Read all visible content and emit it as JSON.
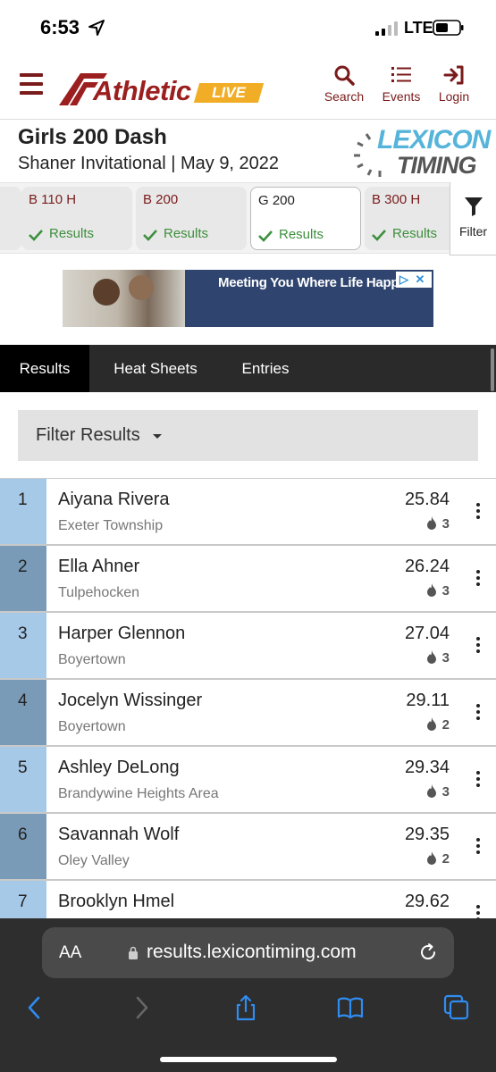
{
  "status_bar": {
    "time": "6:53",
    "network": "LTE"
  },
  "header": {
    "logo_text": "Athletic",
    "logo_badge": "LIVE",
    "nav": [
      {
        "label": "Search",
        "icon": "search-icon"
      },
      {
        "label": "Events",
        "icon": "list-icon"
      },
      {
        "label": "Login",
        "icon": "login-icon"
      }
    ]
  },
  "event": {
    "title": "Girls 200 Dash",
    "subtitle": "Shaner Invitational | May 9, 2022",
    "timer_logo_top": "LEXICON",
    "timer_logo_bottom": "TIMING"
  },
  "event_tabs": [
    {
      "name": "B 110 H",
      "status": "Results",
      "active": false
    },
    {
      "name": "B 200",
      "status": "Results",
      "active": false
    },
    {
      "name": "G 200",
      "status": "Results",
      "active": true
    },
    {
      "name": "B 300 H",
      "status": "Results",
      "active": false
    }
  ],
  "filter_label": "Filter",
  "ad": {
    "text": "Meeting You Where Life Happens"
  },
  "result_tabs": [
    {
      "label": "Results",
      "active": true
    },
    {
      "label": "Heat Sheets",
      "active": false
    },
    {
      "label": "Entries",
      "active": false
    }
  ],
  "filter_results_label": "Filter Results",
  "results": [
    {
      "place": "1",
      "name": "Aiyana Rivera",
      "team": "Exeter Township",
      "mark": "25.84",
      "heat": "3"
    },
    {
      "place": "2",
      "name": "Ella Ahner",
      "team": "Tulpehocken",
      "mark": "26.24",
      "heat": "3"
    },
    {
      "place": "3",
      "name": "Harper Glennon",
      "team": "Boyertown",
      "mark": "27.04",
      "heat": "3"
    },
    {
      "place": "4",
      "name": "Jocelyn Wissinger",
      "team": "Boyertown",
      "mark": "29.11",
      "heat": "2"
    },
    {
      "place": "5",
      "name": "Ashley DeLong",
      "team": "Brandywine Heights Area",
      "mark": "29.34",
      "heat": "3"
    },
    {
      "place": "6",
      "name": "Savannah Wolf",
      "team": "Oley Valley",
      "mark": "29.35",
      "heat": "2"
    },
    {
      "place": "7",
      "name": "Brooklyn Hmel",
      "team": "",
      "mark": "29.62",
      "heat": ""
    }
  ],
  "browser": {
    "aa_label": "AA",
    "url": "results.lexicontiming.com"
  },
  "colors": {
    "brand": "#9c1f1f",
    "accent": "#f1ad26",
    "success": "#3d8f3d",
    "place_light": "#a7c9e8",
    "place_dark": "#7a9bb8"
  }
}
